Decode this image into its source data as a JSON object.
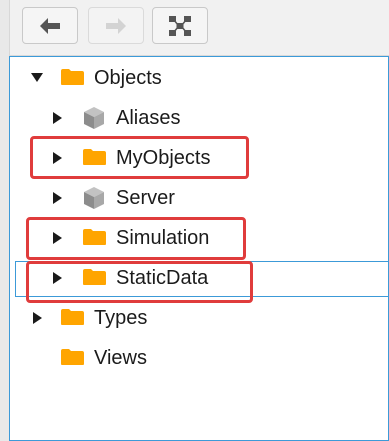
{
  "toolbar": {
    "back_icon": "arrow-left-icon",
    "forward_icon": "arrow-right-icon",
    "network_icon": "network-nodes-icon"
  },
  "tree": {
    "root": {
      "label": "Objects",
      "icon": "folder-icon",
      "expanded": true
    },
    "children": [
      {
        "label": "Aliases",
        "icon": "cube-icon"
      },
      {
        "label": "MyObjects",
        "icon": "folder-icon"
      },
      {
        "label": "Server",
        "icon": "cube-icon"
      },
      {
        "label": "Simulation",
        "icon": "folder-icon"
      },
      {
        "label": "StaticData",
        "icon": "folder-icon"
      }
    ],
    "siblings": [
      {
        "label": "Types",
        "icon": "folder-icon"
      },
      {
        "label": "Views",
        "icon": "folder-icon"
      }
    ]
  },
  "colors": {
    "folder": "#ffa500",
    "cube": "#9a9a9a",
    "highlight": "#e03c3c",
    "selection": "#3c9ad8"
  }
}
